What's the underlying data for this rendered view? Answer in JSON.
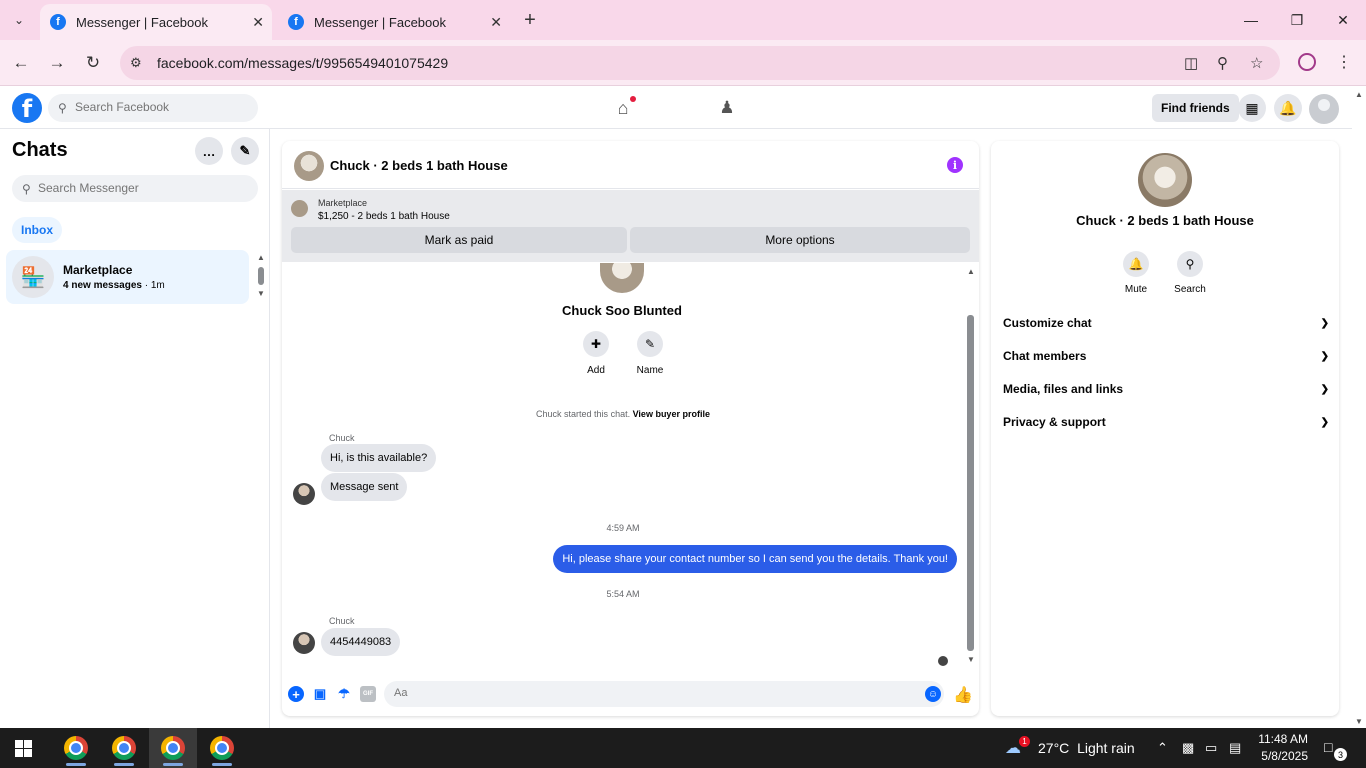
{
  "browser": {
    "tabs": [
      {
        "title": "Messenger | Facebook",
        "active": true
      },
      {
        "title": "Messenger | Facebook",
        "active": false
      }
    ],
    "url": "facebook.com/messages/t/9956549401075429"
  },
  "fb_header": {
    "search_placeholder": "Search Facebook",
    "find_friends": "Find friends"
  },
  "chats": {
    "title": "Chats",
    "search_placeholder": "Search Messenger",
    "filter": "Inbox",
    "items": [
      {
        "name": "Marketplace",
        "preview": "4 new messages",
        "time": " · 1m"
      }
    ]
  },
  "conversation": {
    "title": "Chuck · 2 beds 1 bath House",
    "marketplace_label": "Marketplace",
    "listing": "$1,250 - 2 beds 1 bath House",
    "mark_paid": "Mark as paid",
    "more_options": "More options",
    "profile_name": "Chuck Soo Blunted",
    "actions": [
      {
        "label": "Add"
      },
      {
        "label": "Name"
      }
    ],
    "started_text": "Chuck started this chat.",
    "view_profile": "View buyer profile",
    "messages": [
      {
        "sender": "Chuck",
        "text": "Hi, is this available?"
      },
      {
        "text": "Message sent"
      },
      {
        "timestamp": "4:59 AM"
      },
      {
        "text": "Hi, please share your contact number so I can send you the details. Thank you!"
      },
      {
        "timestamp": "5:54 AM"
      },
      {
        "sender": "Chuck",
        "text": "4454449083"
      }
    ],
    "composer_placeholder": "Aa"
  },
  "info_panel": {
    "name": "Chuck · 2 beds 1 bath House",
    "actions": [
      {
        "label": "Mute"
      },
      {
        "label": "Search"
      }
    ],
    "sections": [
      "Customize chat",
      "Chat members",
      "Media, files and links",
      "Privacy & support"
    ]
  },
  "taskbar": {
    "weather_temp": "27°C",
    "weather_desc": "Light rain",
    "weather_badge": "1",
    "time": "11:48 AM",
    "date": "5/8/2025",
    "notifications": "3"
  },
  "colors": {
    "fb_blue": "#1877f2",
    "outgoing_bubble": "#2b5de8",
    "chrome_tabstrip": "#f9d8ea",
    "info_icon": "#a033ff"
  }
}
